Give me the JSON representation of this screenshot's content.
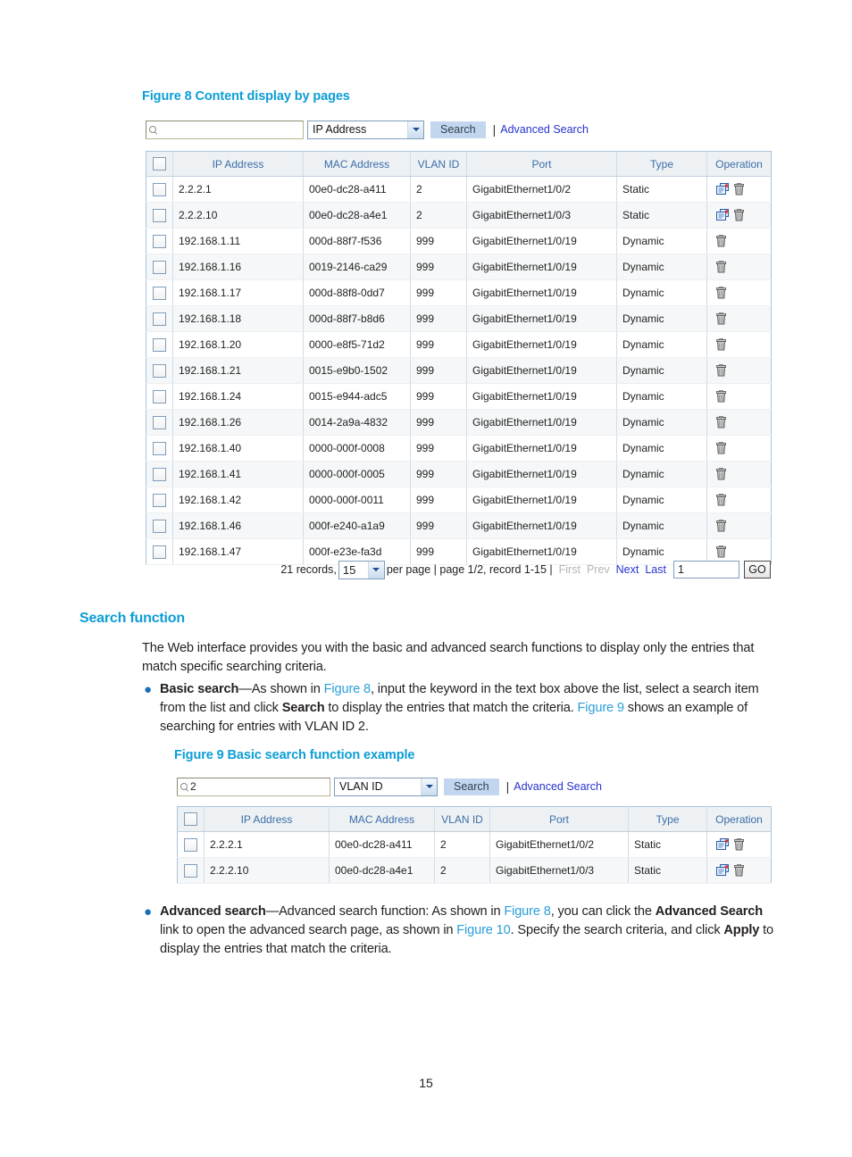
{
  "doc": {
    "page_number": "15"
  },
  "figure8": {
    "caption": "Figure 8 Content display by pages",
    "search": {
      "input_value": "",
      "input_placeholder": "",
      "select_value": "IP Address",
      "search_button": "Search",
      "separator": "|",
      "advanced_link": "Advanced Search"
    },
    "columns": [
      "IP Address",
      "MAC Address",
      "VLAN ID",
      "Port",
      "Type",
      "Operation"
    ],
    "rows": [
      {
        "ip": "2.2.2.1",
        "mac": "00e0-dc28-a411",
        "vlan": "2",
        "port": "GigabitEthernet1/0/2",
        "type": "Static",
        "ops": [
          "edit-icon",
          "delete-icon"
        ]
      },
      {
        "ip": "2.2.2.10",
        "mac": "00e0-dc28-a4e1",
        "vlan": "2",
        "port": "GigabitEthernet1/0/3",
        "type": "Static",
        "ops": [
          "edit-icon",
          "delete-icon"
        ]
      },
      {
        "ip": "192.168.1.11",
        "mac": "000d-88f7-f536",
        "vlan": "999",
        "port": "GigabitEthernet1/0/19",
        "type": "Dynamic",
        "ops": [
          "delete-icon"
        ]
      },
      {
        "ip": "192.168.1.16",
        "mac": "0019-2146-ca29",
        "vlan": "999",
        "port": "GigabitEthernet1/0/19",
        "type": "Dynamic",
        "ops": [
          "delete-icon"
        ]
      },
      {
        "ip": "192.168.1.17",
        "mac": "000d-88f8-0dd7",
        "vlan": "999",
        "port": "GigabitEthernet1/0/19",
        "type": "Dynamic",
        "ops": [
          "delete-icon"
        ]
      },
      {
        "ip": "192.168.1.18",
        "mac": "000d-88f7-b8d6",
        "vlan": "999",
        "port": "GigabitEthernet1/0/19",
        "type": "Dynamic",
        "ops": [
          "delete-icon"
        ]
      },
      {
        "ip": "192.168.1.20",
        "mac": "0000-e8f5-71d2",
        "vlan": "999",
        "port": "GigabitEthernet1/0/19",
        "type": "Dynamic",
        "ops": [
          "delete-icon"
        ]
      },
      {
        "ip": "192.168.1.21",
        "mac": "0015-e9b0-1502",
        "vlan": "999",
        "port": "GigabitEthernet1/0/19",
        "type": "Dynamic",
        "ops": [
          "delete-icon"
        ]
      },
      {
        "ip": "192.168.1.24",
        "mac": "0015-e944-adc5",
        "vlan": "999",
        "port": "GigabitEthernet1/0/19",
        "type": "Dynamic",
        "ops": [
          "delete-icon"
        ]
      },
      {
        "ip": "192.168.1.26",
        "mac": "0014-2a9a-4832",
        "vlan": "999",
        "port": "GigabitEthernet1/0/19",
        "type": "Dynamic",
        "ops": [
          "delete-icon"
        ]
      },
      {
        "ip": "192.168.1.40",
        "mac": "0000-000f-0008",
        "vlan": "999",
        "port": "GigabitEthernet1/0/19",
        "type": "Dynamic",
        "ops": [
          "delete-icon"
        ]
      },
      {
        "ip": "192.168.1.41",
        "mac": "0000-000f-0005",
        "vlan": "999",
        "port": "GigabitEthernet1/0/19",
        "type": "Dynamic",
        "ops": [
          "delete-icon"
        ]
      },
      {
        "ip": "192.168.1.42",
        "mac": "0000-000f-0011",
        "vlan": "999",
        "port": "GigabitEthernet1/0/19",
        "type": "Dynamic",
        "ops": [
          "delete-icon"
        ]
      },
      {
        "ip": "192.168.1.46",
        "mac": "000f-e240-a1a9",
        "vlan": "999",
        "port": "GigabitEthernet1/0/19",
        "type": "Dynamic",
        "ops": [
          "delete-icon"
        ]
      },
      {
        "ip": "192.168.1.47",
        "mac": "000f-e23e-fa3d",
        "vlan": "999",
        "port": "GigabitEthernet1/0/19",
        "type": "Dynamic",
        "ops": [
          "delete-icon"
        ]
      }
    ],
    "pager": {
      "records_label": "21 records,",
      "per_page_value": "15",
      "per_page_label": "per page | page 1/2, record 1-15 |",
      "first": "First",
      "prev": "Prev",
      "next": "Next",
      "last": "Last",
      "page_input_value": "1",
      "go_button": "GO"
    }
  },
  "search_section": {
    "heading": "Search function",
    "intro": "The Web interface provides you with the basic and advanced search functions to display only the entries that match specific searching criteria.",
    "bullet_basic": {
      "lead": "Basic search",
      "t1": "—As shown in ",
      "ref1": "Figure 8",
      "t2": ", input the keyword in the text box above the list, select a search item from the list and click ",
      "b1": "Search",
      "t3": " to display the entries that match the criteria. ",
      "ref2": "Figure 9",
      "t4": " shows an example of searching for entries with VLAN ID 2."
    },
    "bullet_advanced": {
      "lead": "Advanced search",
      "t1": "—Advanced search function: As shown in ",
      "ref1": "Figure 8",
      "t2": ", you can click the ",
      "b1": "Advanced Search",
      "t3": " link to open the advanced search page, as shown in ",
      "ref2": "Figure 10",
      "t4": ". Specify the search criteria, and click ",
      "b2": "Apply",
      "t5": " to display the entries that match the criteria."
    }
  },
  "figure9": {
    "caption": "Figure 9 Basic search function example",
    "search": {
      "input_value": "2",
      "select_value": "VLAN ID",
      "search_button": "Search",
      "separator": "|",
      "advanced_link": "Advanced Search"
    },
    "columns": [
      "IP Address",
      "MAC Address",
      "VLAN ID",
      "Port",
      "Type",
      "Operation"
    ],
    "rows": [
      {
        "ip": "2.2.2.1",
        "mac": "00e0-dc28-a411",
        "vlan": "2",
        "port": "GigabitEthernet1/0/2",
        "type": "Static",
        "ops": [
          "edit-icon",
          "delete-icon"
        ]
      },
      {
        "ip": "2.2.2.10",
        "mac": "00e0-dc28-a4e1",
        "vlan": "2",
        "port": "GigabitEthernet1/0/3",
        "type": "Static",
        "ops": [
          "edit-icon",
          "delete-icon"
        ]
      }
    ]
  },
  "colors": {
    "caption_blue": "#0b9dd6",
    "xref_blue": "#2a9fd8",
    "header_text_blue": "#3b6ea8",
    "link_blue": "#2633cc",
    "search_btn_bg": "#c2d7ef"
  }
}
